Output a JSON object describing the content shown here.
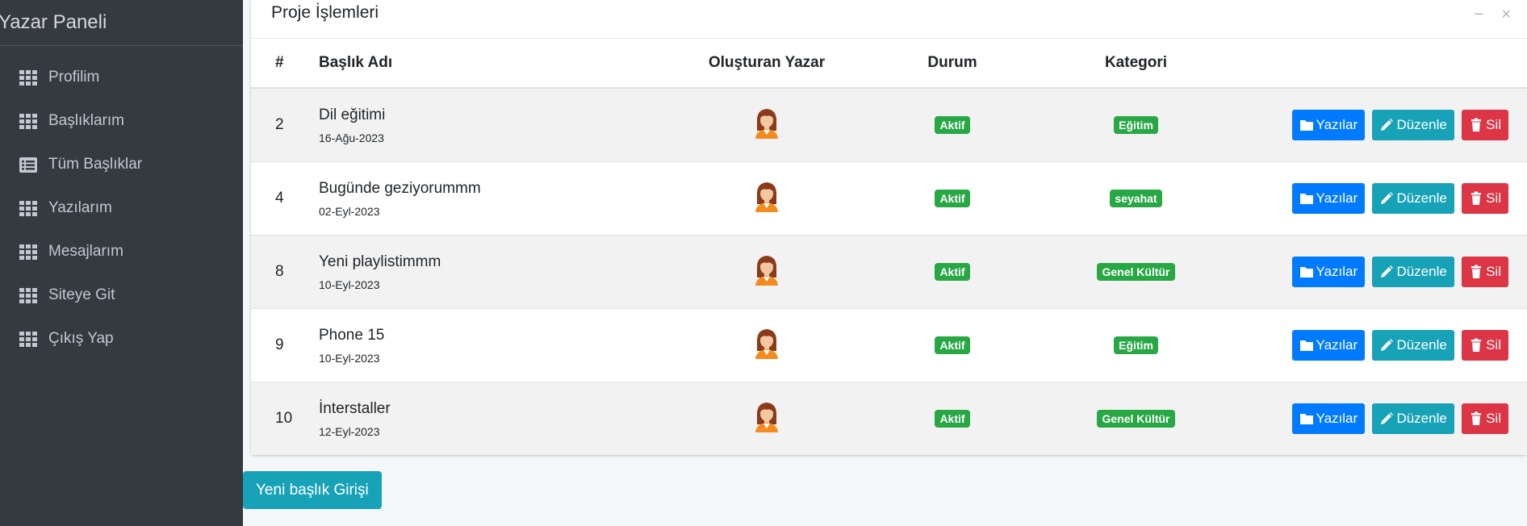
{
  "sidebar": {
    "brand": "Yazar Paneli",
    "items": [
      {
        "label": "Profilim",
        "icon": "grid-icon"
      },
      {
        "label": "Başlıklarım",
        "icon": "grid-icon"
      },
      {
        "label": "Tüm Başlıklar",
        "icon": "list-icon"
      },
      {
        "label": "Yazılarım",
        "icon": "grid-icon"
      },
      {
        "label": "Mesajlarım",
        "icon": "grid-icon"
      },
      {
        "label": "Siteye Git",
        "icon": "grid-icon"
      },
      {
        "label": "Çıkış Yap",
        "icon": "grid-icon"
      }
    ]
  },
  "card": {
    "title": "Proje İşlemleri",
    "minimize_symbol": "−",
    "close_symbol": "×"
  },
  "table": {
    "headers": [
      "#",
      "Başlık Adı",
      "Oluşturan Yazar",
      "Durum",
      "Kategori"
    ],
    "rows": [
      {
        "id": "2",
        "title": "Dil eğitimi",
        "date": "16-Ağu-2023",
        "status": "Aktif",
        "category": "Eğitim"
      },
      {
        "id": "4",
        "title": "Bugünde geziyorummm",
        "date": "02-Eyl-2023",
        "status": "Aktif",
        "category": "seyahat"
      },
      {
        "id": "8",
        "title": "Yeni playlistimmm",
        "date": "10-Eyl-2023",
        "status": "Aktif",
        "category": "Genel Kültür"
      },
      {
        "id": "9",
        "title": "Phone 15",
        "date": "10-Eyl-2023",
        "status": "Aktif",
        "category": "Eğitim"
      },
      {
        "id": "10",
        "title": "İnterstaller",
        "date": "12-Eyl-2023",
        "status": "Aktif",
        "category": "Genel Kültür"
      }
    ],
    "actions": {
      "posts": "Yazılar",
      "edit": "Düzenle",
      "delete": "Sil"
    }
  },
  "new_button": "Yeni başlık Girişi",
  "colors": {
    "sidebar_bg": "#343a40",
    "primary": "#007bff",
    "info": "#17a2b8",
    "danger": "#dc3545",
    "success": "#28a745"
  }
}
